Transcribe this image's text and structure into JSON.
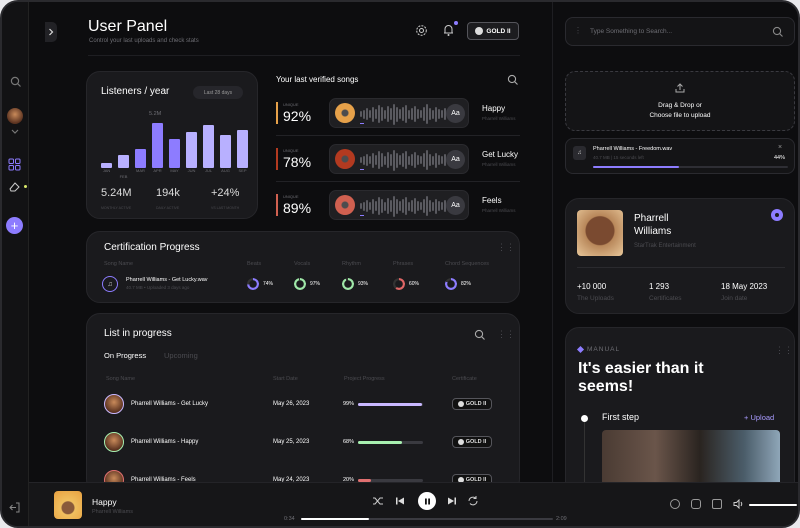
{
  "header": {
    "title": "User Panel",
    "subtitle": "Control your last uploads and check stats",
    "badge": "GOLD II"
  },
  "listeners": {
    "title": "Listeners / year",
    "range": "Last 28 days",
    "peak_label": "5.2M",
    "months": [
      "JAN",
      "FEB",
      "MAR",
      "APR",
      "MAY",
      "JUN",
      "JUL",
      "AUG",
      "SEP"
    ],
    "values": [
      0.4,
      1.1,
      1.6,
      3.8,
      2.4,
      3.0,
      3.6,
      2.8,
      3.2
    ],
    "highlight": [
      false,
      false,
      true,
      true,
      true,
      false,
      false,
      false,
      false
    ],
    "stats": [
      {
        "value": "5.24M",
        "label": "MONTHLY ACTIVE"
      },
      {
        "value": "194k",
        "label": "DAILY ACTIVE"
      },
      {
        "value": "+24%",
        "label": "VS LAST MONTH"
      }
    ]
  },
  "verified": {
    "title": "Your last verified songs",
    "songs": [
      {
        "tag": "UNIQUE",
        "pct": "92%",
        "name": "Happy",
        "artist": "Pharrell Williams",
        "aa": "Aa",
        "color": "#e6a14a"
      },
      {
        "tag": "UNIQUE",
        "pct": "78%",
        "name": "Get Lucky",
        "artist": "Pharrell Williams",
        "aa": "Aa",
        "color": "#b33a20"
      },
      {
        "tag": "UNIQUE",
        "pct": "89%",
        "name": "Feels",
        "artist": "Pharrell Williams",
        "aa": "Aa",
        "color": "#d06050"
      }
    ]
  },
  "cert": {
    "title": "Certification Progress",
    "col_song": "Song Name",
    "cols": [
      {
        "name": "Beats",
        "pct": "74%",
        "color": "#8d7cff"
      },
      {
        "name": "Vocals",
        "pct": "97%",
        "color": "#9fe8a8"
      },
      {
        "name": "Rhythm",
        "pct": "93%",
        "color": "#9fe8a8"
      },
      {
        "name": "Phrases",
        "pct": "60%",
        "color": "#e06666"
      },
      {
        "name": "Chord Sequences",
        "pct": "82%",
        "color": "#8d7cff"
      }
    ],
    "song": "Pharrell Williams - Get Lucky.wav",
    "meta": "40.7 MB • Uploaded 3 days ago"
  },
  "list": {
    "title": "List in progress",
    "tabs": [
      "On Progress",
      "Upcoming"
    ],
    "cols": [
      "Song Name",
      "Start Date",
      "Project Progress",
      "Certificate"
    ],
    "rows": [
      {
        "name": "Pharrell Williams - Get Lucky",
        "date": "May 26, 2023",
        "pct": "99%",
        "p": 0.99,
        "color": "#c9b8ff",
        "cert": "GOLD II"
      },
      {
        "name": "Pharrell Williams - Happy",
        "date": "May 25, 2023",
        "pct": "68%",
        "p": 0.68,
        "color": "#a8f0b0",
        "cert": "GOLD II"
      },
      {
        "name": "Pharrell Williams - Feels",
        "date": "May 24, 2023",
        "pct": "20%",
        "p": 0.2,
        "color": "#e07070",
        "cert": "GOLD II"
      }
    ]
  },
  "right": {
    "search_placeholder": "Type Something to Search...",
    "drop_line1": "Drag & Drop or",
    "drop_line2": "Choose file to upload",
    "upload": {
      "file": "Pharrell Williams - Freedom.wav",
      "meta": "40.7 MB | 15 seconds left",
      "pct": "44%",
      "p": 0.44
    },
    "artist": {
      "first": "Pharrell",
      "last": "Williams",
      "label": "StarTrak Entertainment",
      "stats": [
        {
          "value": "+10 000",
          "label": "The Uploads"
        },
        {
          "value": "1 293",
          "label": "Certificates"
        },
        {
          "value": "18 May 2023",
          "label": "Join date"
        }
      ]
    },
    "manual": {
      "tag": "MANUAL",
      "title1": "It's easier than it",
      "title2": "seems!",
      "step": "First step",
      "action": "+ Upload"
    }
  },
  "player": {
    "song": "Happy",
    "artist": "Pharrell Williams",
    "elapsed": "0:34",
    "total": "2:09",
    "progress": 0.27
  }
}
